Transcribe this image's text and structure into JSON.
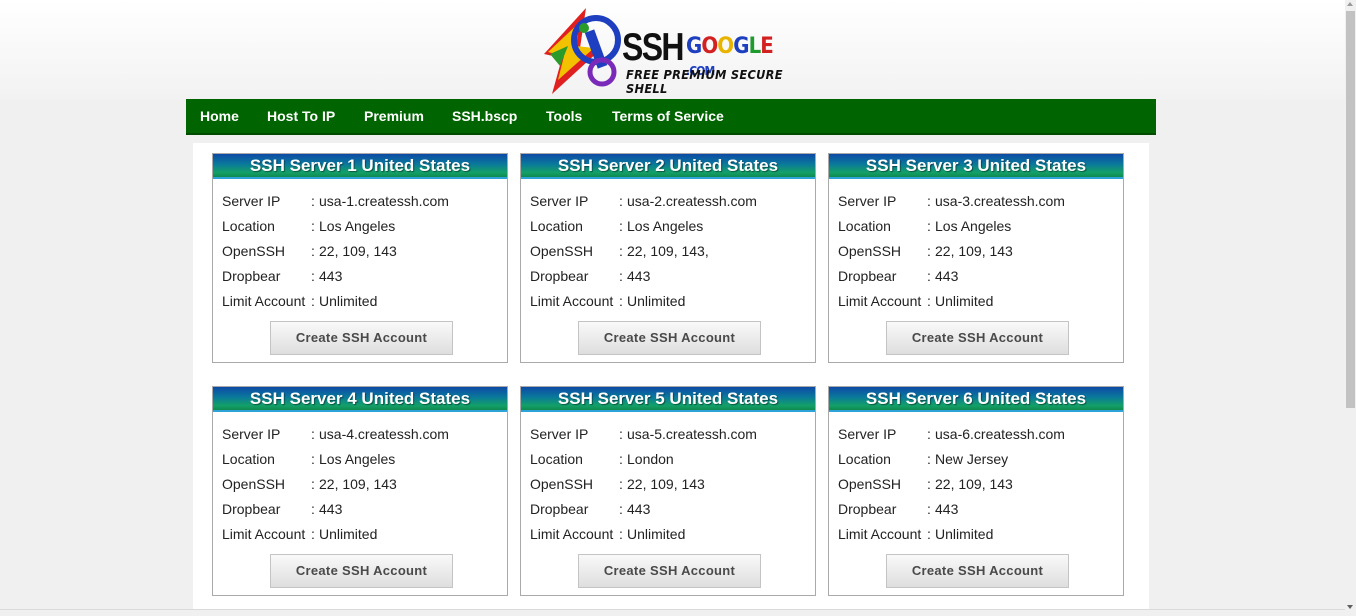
{
  "logo": {
    "ssh": "SSH",
    "google_letters": [
      {
        "ch": "G",
        "color": "#1e3fbf"
      },
      {
        "ch": "O",
        "color": "#d32020"
      },
      {
        "ch": "O",
        "color": "#e8b400"
      },
      {
        "ch": "G",
        "color": "#1e3fbf"
      },
      {
        "ch": "L",
        "color": "#1f9a2c"
      },
      {
        "ch": "E",
        "color": "#d32020"
      },
      {
        "ch": ".COM",
        "color": "#1e3fbf"
      }
    ],
    "tagline": "FREE PREMIUM SECURE SHELL"
  },
  "nav": {
    "items": [
      {
        "label": "Home"
      },
      {
        "label": "Host To IP"
      },
      {
        "label": "Premium"
      },
      {
        "label": "SSH.bscp"
      },
      {
        "label": "Tools"
      },
      {
        "label": "Terms of Service"
      }
    ]
  },
  "fields": {
    "server_ip": "Server IP",
    "location": "Location",
    "openssh": "OpenSSH",
    "dropbear": "Dropbear",
    "limit": "Limit Account",
    "separator": ":"
  },
  "servers": [
    {
      "title": "SSH Server 1 United States",
      "server_ip": "usa-1.createssh.com",
      "location": "Los Angeles",
      "openssh": "22, 109, 143",
      "dropbear": "443",
      "limit": "Unlimited",
      "button": "Create SSH Account"
    },
    {
      "title": "SSH Server 2 United States",
      "server_ip": "usa-2.createssh.com",
      "location": "Los Angeles",
      "openssh": "22, 109, 143,",
      "dropbear": "443",
      "limit": "Unlimited",
      "button": "Create SSH Account"
    },
    {
      "title": "SSH Server 3 United States",
      "server_ip": "usa-3.createssh.com",
      "location": "Los Angeles",
      "openssh": "22, 109, 143",
      "dropbear": "443",
      "limit": "Unlimited",
      "button": "Create SSH Account"
    },
    {
      "title": "SSH Server 4 United States",
      "server_ip": "usa-4.createssh.com",
      "location": "Los Angeles",
      "openssh": "22, 109, 143",
      "dropbear": "443",
      "limit": "Unlimited",
      "button": "Create SSH Account"
    },
    {
      "title": "SSH Server 5 United States",
      "server_ip": "usa-5.createssh.com",
      "location": "London",
      "openssh": "22, 109, 143",
      "dropbear": "443",
      "limit": "Unlimited",
      "button": "Create SSH Account"
    },
    {
      "title": "SSH Server 6 United States",
      "server_ip": "usa-6.createssh.com",
      "location": "New Jersey",
      "openssh": "22, 109, 143",
      "dropbear": "443",
      "limit": "Unlimited",
      "button": "Create SSH Account"
    }
  ],
  "colors": {
    "nav_bg": "#006400",
    "card_header_top": "#0d4aa5",
    "card_header_bottom": "#13a068"
  }
}
